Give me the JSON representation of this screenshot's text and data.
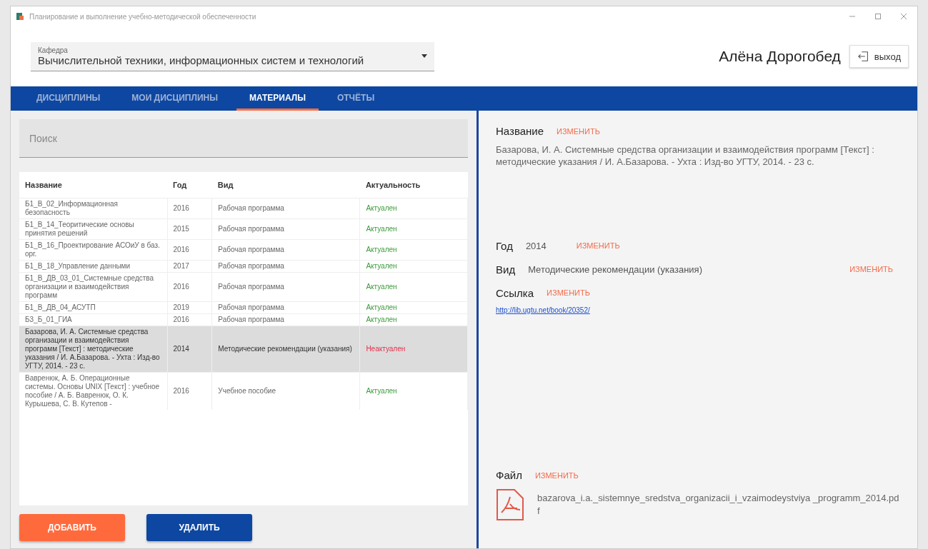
{
  "window": {
    "title": "Планирование и выполнение учебно-методической обеспеченности"
  },
  "department": {
    "label": "Кафедра",
    "value": "Вычислительной техники, информационных систем и технологий"
  },
  "user": {
    "name": "Алёна Дорогобед",
    "logout": "выход"
  },
  "tabs": [
    {
      "label": "ДИСЦИПЛИНЫ",
      "selected": false
    },
    {
      "label": "МОИ ДИСЦИПЛИНЫ",
      "selected": false
    },
    {
      "label": "МАТЕРИАЛЫ",
      "selected": true
    },
    {
      "label": "ОТЧЁТЫ",
      "selected": false
    }
  ],
  "search": {
    "placeholder": "Поиск"
  },
  "table": {
    "columns": [
      "Название",
      "Год",
      "Вид",
      "Актуальность"
    ],
    "rows": [
      {
        "name": "Б1_В_02_Информационная безопасность",
        "year": "2016",
        "type": "Рабочая программа",
        "status": "Актуален",
        "actual": true,
        "selected": false
      },
      {
        "name": "Б1_В_14_Теоритические основы принятия решений",
        "year": "2015",
        "type": "Рабочая программа",
        "status": "Актуален",
        "actual": true,
        "selected": false
      },
      {
        "name": "Б1_В_16_Проектирование АСОиУ в баз. орг.",
        "year": "2016",
        "type": "Рабочая программа",
        "status": "Актуален",
        "actual": true,
        "selected": false
      },
      {
        "name": "Б1_В_18_Управление данными",
        "year": "2017",
        "type": "Рабочая программа",
        "status": "Актуален",
        "actual": true,
        "selected": false
      },
      {
        "name": "Б1_В_ДВ_03_01_Системные средства организации и взаимодействия программ",
        "year": "2016",
        "type": "Рабочая программа",
        "status": "Актуален",
        "actual": true,
        "selected": false
      },
      {
        "name": "Б1_В_ДВ_04_АСУТП",
        "year": "2019",
        "type": "Рабочая программа",
        "status": "Актуален",
        "actual": true,
        "selected": false
      },
      {
        "name": "Б3_Б_01_ГИА",
        "year": "2016",
        "type": "Рабочая программа",
        "status": "Актуален",
        "actual": true,
        "selected": false
      },
      {
        "name": "Базарова, И. А. Системные средства организации и взаимодействия программ [Текст] : методические указания / И. А.Базарова. - Ухта : Изд-во УГТУ, 2014. - 23 с.",
        "year": "2014",
        "type": "Методические рекомендации (указания)",
        "status": "Неактуален",
        "actual": false,
        "selected": true
      },
      {
        "name": "Вавренюк, А. Б. Операционные системы. Основы UNIX [Текст] : учебное пособие / А. Б. Вавренюк, О. К. Курышева, С. В. Кутепов -",
        "year": "2016",
        "type": "Учебное пособие",
        "status": "Актуален",
        "actual": true,
        "selected": false
      }
    ]
  },
  "buttons": {
    "add": "ДОБАВИТЬ",
    "delete": "УДАЛИТЬ"
  },
  "details": {
    "title_edit": "ИЗМЕНИТЬ",
    "year_edit": "ИЗМЕНИТЬ",
    "type_edit": "ИЗМЕНИТЬ",
    "link_edit": "ИЗМЕНИТЬ",
    "file_edit": "ИЗМЕНИТЬ",
    "title_label": "Название",
    "title_value": "Базарова, И. А. Системные средства организации и взаимодействия программ  [Текст] : методические указания / И. А.Базарова. - Ухта : Изд-во УГТУ, 2014. - 23 с.",
    "year_label": "Год",
    "year_value": "2014",
    "type_label": "Вид",
    "type_value": "Методические рекомендации (указания)",
    "link_label": "Ссылка",
    "link_value": "http://lib.ugtu.net/book/20352/",
    "file_label": "Файл",
    "file_name": "bazarova_i.a._sistemnye_sredstva_organizacii_i_vzaimodeystviya _programm_2014.pdf"
  }
}
